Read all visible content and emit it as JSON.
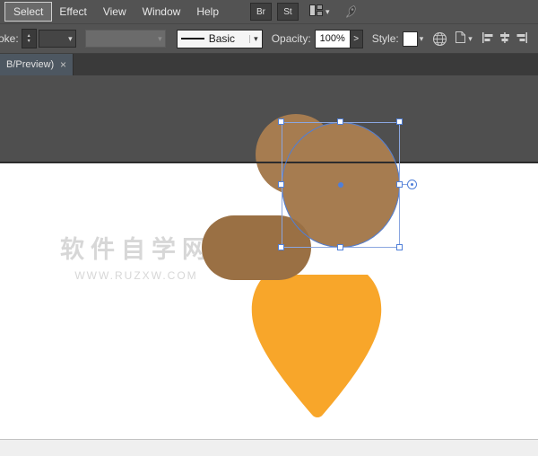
{
  "menu_bar": {
    "items": [
      {
        "label": "Select",
        "active": true
      },
      {
        "label": "Effect",
        "active": false
      },
      {
        "label": "View",
        "active": false
      },
      {
        "label": "Window",
        "active": false
      },
      {
        "label": "Help",
        "active": false
      }
    ],
    "brush_button": "Br",
    "style_button": "St"
  },
  "options_bar": {
    "stroke_label": "oke:",
    "line_style_value": "Basic",
    "opacity_label": "Opacity:",
    "opacity_value": "100%",
    "style_label": "Style:"
  },
  "document_tab": {
    "title": "B/Preview)"
  },
  "watermark": {
    "title": "软件自学网",
    "url": "www.ruzxw.com"
  },
  "icons": {
    "chevron_down": "▾",
    "chevron_up": "▴",
    "more": ">",
    "close": "×"
  },
  "colors": {
    "acorn_brown": "#a67c50",
    "acorn_brown_dark": "#9a7044",
    "acorn_orange": "#f8a62a",
    "selection_blue": "#4f7fd9",
    "ui_gray": "#535353"
  }
}
